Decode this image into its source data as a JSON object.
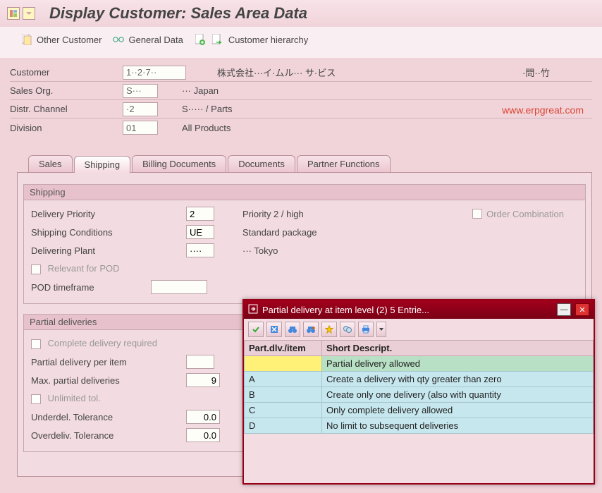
{
  "title": "Display Customer: Sales Area Data",
  "toolbar": {
    "other_customer": "Other Customer",
    "general_data": "General Data",
    "customer_hierarchy": "Customer hierarchy"
  },
  "header": {
    "customer_label": "Customer",
    "customer_value": "1··2·7··",
    "customer_desc1": "株式会社···イ·ムル··· サ·ビス",
    "customer_desc2": "·問··竹",
    "sales_org_label": "Sales Org.",
    "sales_org_value": "S···",
    "sales_org_desc": "··· Japan",
    "distr_channel_label": "Distr. Channel",
    "distr_channel_value": "·2",
    "distr_channel_desc": "S····· / Parts",
    "division_label": "Division",
    "division_value": "01",
    "division_desc": "All Products"
  },
  "tabs": {
    "sales": "Sales",
    "shipping": "Shipping",
    "billing": "Billing Documents",
    "documents": "Documents",
    "partner": "Partner Functions"
  },
  "shipping_group": {
    "title": "Shipping",
    "delivery_priority_label": "Delivery Priority",
    "delivery_priority_value": "2",
    "delivery_priority_desc": "Priority 2 / high",
    "order_combination_label": "Order Combination",
    "shipping_conditions_label": "Shipping Conditions",
    "shipping_conditions_value": "UE",
    "shipping_conditions_desc": "Standard  package",
    "delivering_plant_label": "Delivering Plant",
    "delivering_plant_value": "····",
    "delivering_plant_desc": "··· Tokyo",
    "relevant_pod_label": "Relevant for POD",
    "pod_timeframe_label": "POD timeframe",
    "pod_timeframe_value": ""
  },
  "partial_group": {
    "title": "Partial deliveries",
    "complete_delivery_label": "Complete delivery required",
    "partial_per_item_label": "Partial delivery per item",
    "partial_per_item_value": "",
    "max_partial_label": "Max. partial deliveries",
    "max_partial_value": "9",
    "unlimited_tol_label": "Unlimited tol.",
    "underdel_label": "Underdel. Tolerance",
    "underdel_value": "0.0",
    "overdel_label": "Overdeliv. Tolerance",
    "overdel_value": "0.0"
  },
  "popup": {
    "title": "Partial delivery at item level (2)    5 Entrie...",
    "col1": "Part.dlv./item",
    "col2": "Short Descript.",
    "rows": [
      {
        "code": "",
        "desc": "Partial delivery allowed"
      },
      {
        "code": "A",
        "desc": "Create a delivery with qty greater than zero"
      },
      {
        "code": "B",
        "desc": "Create only one delivery (also with quantity"
      },
      {
        "code": "C",
        "desc": "Only complete delivery allowed"
      },
      {
        "code": "D",
        "desc": "No limit to subsequent deliveries"
      }
    ]
  },
  "watermark": "www.erpgreat.com"
}
